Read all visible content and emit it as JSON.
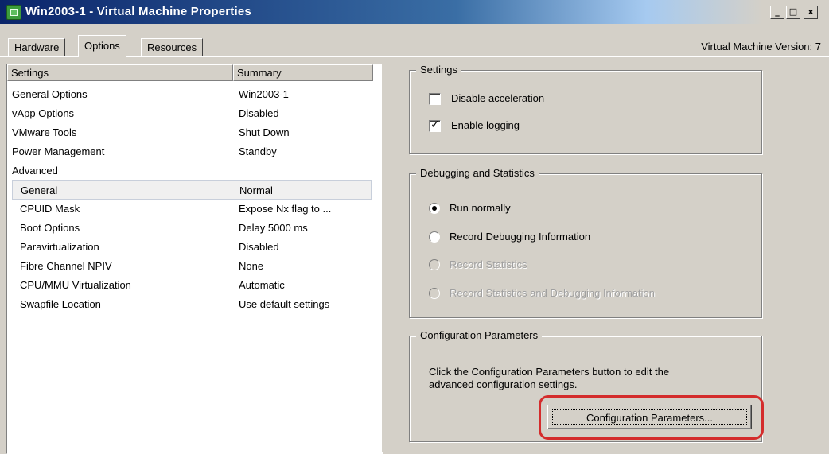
{
  "window": {
    "title": "Win2003-1 - Virtual Machine Properties",
    "minimize_glyph": "_",
    "maximize_glyph": "□",
    "close_glyph": "x"
  },
  "tabs": [
    {
      "label": "Hardware",
      "active": false
    },
    {
      "label": "Options",
      "active": true
    },
    {
      "label": "Resources",
      "active": false
    }
  ],
  "vm_version": "Virtual Machine Version: 7",
  "list": {
    "columns": [
      "Settings",
      "Summary"
    ],
    "rows": [
      {
        "setting": "General Options",
        "summary": "Win2003-1"
      },
      {
        "setting": "vApp Options",
        "summary": "Disabled"
      },
      {
        "setting": "VMware Tools",
        "summary": "Shut Down"
      },
      {
        "setting": "Power Management",
        "summary": "Standby"
      },
      {
        "setting": "Advanced",
        "summary": ""
      },
      {
        "setting": "General",
        "summary": "Normal"
      },
      {
        "setting": "CPUID Mask",
        "summary": "Expose Nx flag to ..."
      },
      {
        "setting": "Boot Options",
        "summary": "Delay 5000 ms"
      },
      {
        "setting": "Paravirtualization",
        "summary": "Disabled"
      },
      {
        "setting": "Fibre Channel NPIV",
        "summary": "None"
      },
      {
        "setting": "CPU/MMU Virtualization",
        "summary": "Automatic"
      },
      {
        "setting": "Swapfile Location",
        "summary": "Use default settings"
      }
    ]
  },
  "settings_group": {
    "title": "Settings",
    "disable_acceleration": {
      "label": "Disable acceleration",
      "checked": false
    },
    "enable_logging": {
      "label": "Enable logging",
      "checked": true,
      "check_glyph": "✓"
    }
  },
  "debugging_group": {
    "title": "Debugging and Statistics",
    "options": [
      {
        "label": "Run normally",
        "selected": true,
        "enabled": true
      },
      {
        "label": "Record Debugging Information",
        "selected": false,
        "enabled": true
      },
      {
        "label": "Record Statistics",
        "selected": false,
        "enabled": false
      },
      {
        "label": "Record Statistics and Debugging Information",
        "selected": false,
        "enabled": false
      }
    ]
  },
  "config_group": {
    "title": "Configuration Parameters",
    "description_line1": "Click the Configuration Parameters button to edit the",
    "description_line2": "advanced configuration settings.",
    "button_label": "Configuration Parameters..."
  },
  "colors": {
    "highlight_ring": "#d42c2c",
    "title_bar": "#0a246a",
    "dialog_bg": "#d4d0c8"
  },
  "icons": {
    "title": "vm-icon",
    "minimize": "minimize-icon",
    "maximize": "maximize-icon",
    "close": "close-icon"
  }
}
